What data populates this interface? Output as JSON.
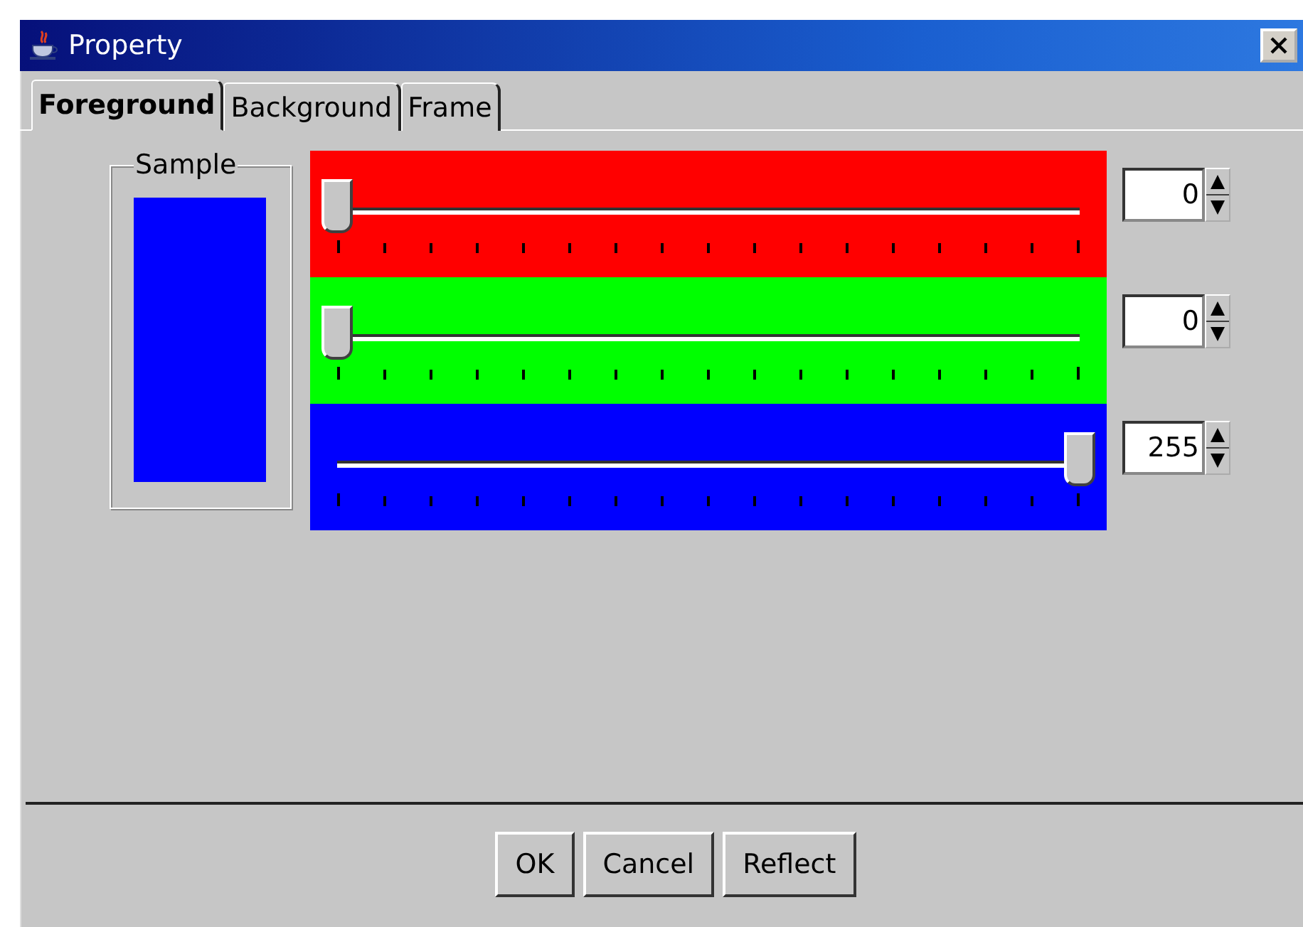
{
  "window": {
    "title": "Property"
  },
  "tabs": [
    {
      "label": "Foreground",
      "selected": true
    },
    {
      "label": "Background",
      "selected": false
    },
    {
      "label": "Frame",
      "selected": false
    }
  ],
  "sample": {
    "label": "Sample",
    "color": "#0000ff"
  },
  "channels": [
    {
      "color": "#ff0000",
      "level": 0,
      "value": "0"
    },
    {
      "color": "#00ff00",
      "level": 0,
      "value": "0"
    },
    {
      "color": "#0000ff",
      "level": 1,
      "value": "255"
    }
  ],
  "buttons": [
    "OK",
    "Cancel",
    "Reflect"
  ]
}
